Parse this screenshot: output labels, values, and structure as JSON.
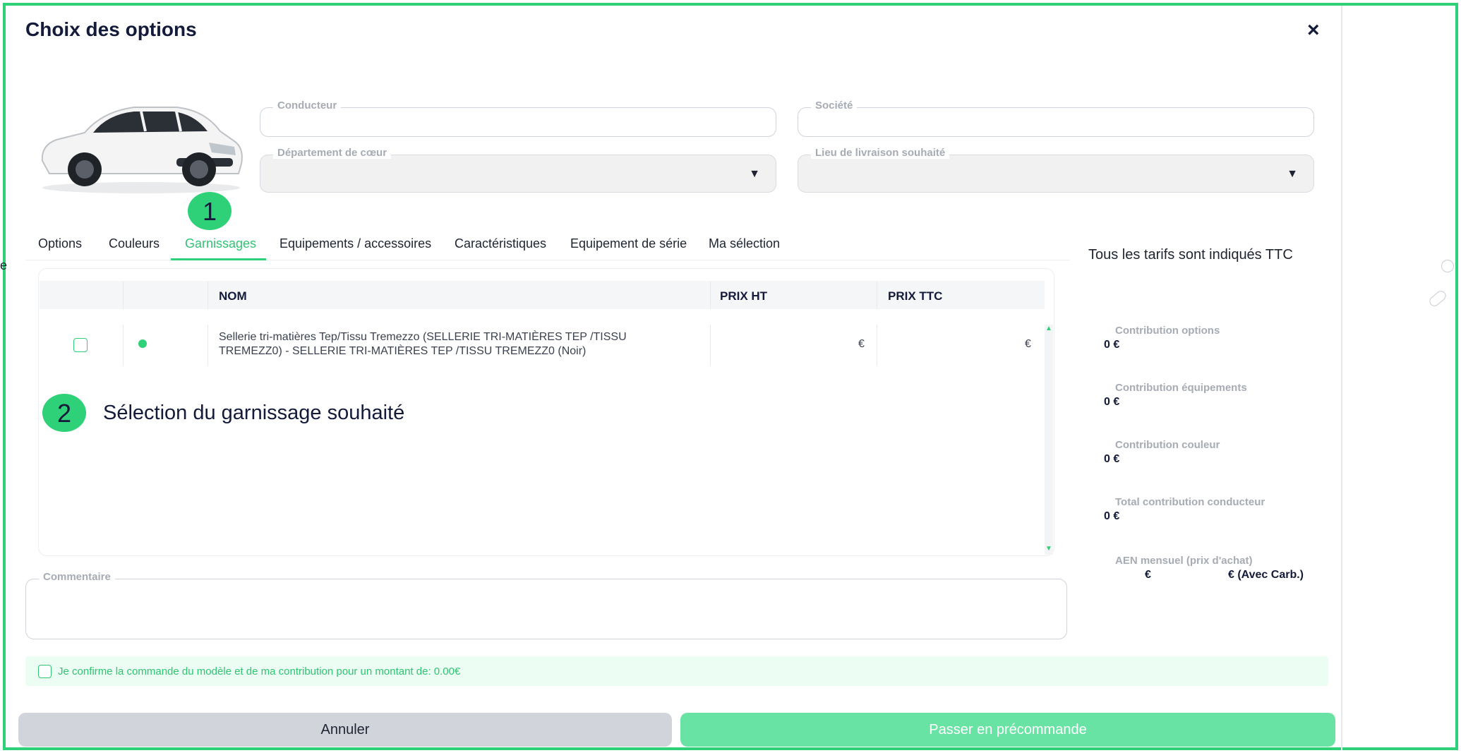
{
  "dialog": {
    "title": "Choix des options",
    "close_glyph": "×"
  },
  "form": {
    "conducteur": {
      "label": "Conducteur",
      "value": ""
    },
    "societe": {
      "label": "Société",
      "value": ""
    },
    "departement": {
      "label": "Département de cœur",
      "value": ""
    },
    "livraison": {
      "label": "Lieu de livraison souhaité",
      "value": ""
    },
    "caret": "▼"
  },
  "tabs": [
    {
      "label": "Options"
    },
    {
      "label": "Couleurs"
    },
    {
      "label": "Garnissages",
      "active": true
    },
    {
      "label": "Equipements / accessoires"
    },
    {
      "label": "Caractéristiques"
    },
    {
      "label": "Equipement de série"
    },
    {
      "label": "Ma sélection"
    }
  ],
  "annotations": {
    "badge1": "1",
    "badge2": "2",
    "step2_text": "Sélection du garnissage souhaité"
  },
  "table": {
    "headers": {
      "nom": "NOM",
      "prix_ht": "PRIX HT",
      "prix_ttc": "PRIX TTC"
    },
    "rows": [
      {
        "nom_line1": "Sellerie tri-matières Tep/Tissu Tremezzo (SELLERIE TRI-MATIÈRES TEP /TISSU",
        "nom_line2": "TREMEZZ0) - SELLERIE TRI-MATIÈRES TEP /TISSU TREMEZZ0 (Noir)",
        "prix_ht": "€",
        "prix_ttc": "€",
        "checked": false
      }
    ],
    "scroll_up": "▲",
    "scroll_down": "▼"
  },
  "summary": {
    "heading": "Tous les tarifs sont indiqués TTC",
    "items": [
      {
        "label": "Contribution options",
        "value": "0 €"
      },
      {
        "label": "Contribution équipements",
        "value": "0 €"
      },
      {
        "label": "Contribution couleur",
        "value": "0 €"
      },
      {
        "label": "Total contribution conducteur",
        "value": "0 €"
      }
    ],
    "aen": {
      "label": "AEN mensuel (prix d'achat)",
      "value1": "€",
      "value2": "€ (Avec Carb.)"
    }
  },
  "comment": {
    "label": "Commentaire",
    "value": ""
  },
  "confirm": {
    "text": "Je confirme la commande du modèle et de ma contribution pour un montant de: 0.00€",
    "checked": false
  },
  "actions": {
    "cancel": "Annuler",
    "submit": "Passer en précommande"
  },
  "edge": {
    "partial_letter": "e"
  },
  "colors": {
    "accent": "#2fd178",
    "accent_text": "#2fc472",
    "submit_bg": "#69e3a4",
    "cancel_bg": "#d1d5db",
    "title": "#141a3a"
  }
}
